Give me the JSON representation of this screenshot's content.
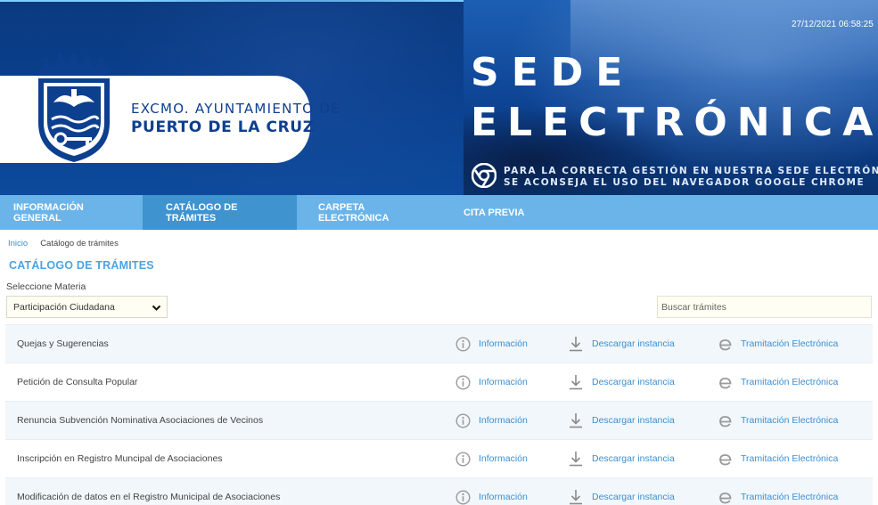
{
  "header": {
    "org_line1": "EXCMO. AYUNTAMIENTO DE",
    "org_line2": "PUERTO DE LA CRUZ",
    "title_line1": "SEDE",
    "title_line2": "ELECTRÓNICA",
    "chrome_note_line1": "PARA LA CORRECTA GESTIÓN EN NUESTRA SEDE ELECTRÓNICA",
    "chrome_note_line2": "SE ACONSEJA EL USO DEL NAVEGADOR GOOGLE CHROME",
    "datetime": "27/12/2021 06:58:25"
  },
  "nav": {
    "items": [
      {
        "label": "INFORMACIÓN GENERAL"
      },
      {
        "label": "CATÁLOGO DE TRÁMITES"
      },
      {
        "label": "CARPETA ELECTRÓNICA"
      },
      {
        "label": "CITA PREVIA"
      }
    ]
  },
  "breadcrumb": {
    "home": "Inicio",
    "current": "Catálogo de trámites"
  },
  "page": {
    "title": "CATÁLOGO DE TRÁMITES",
    "materia_label": "Seleccione Materia",
    "materia_selected": "Participación Ciudadana",
    "search_placeholder": "Buscar trámites"
  },
  "actions": {
    "info": "Información",
    "download": "Descargar instancia",
    "tramitacion": "Tramitación Electrónica"
  },
  "procedures": [
    {
      "name": "Quejas y Sugerencias"
    },
    {
      "name": "Petición de Consulta Popular"
    },
    {
      "name": "Renuncia Subvención Nominativa Asociaciones de Vecinos"
    },
    {
      "name": "Inscripción en Registro Muncipal de Asociaciones"
    },
    {
      "name": "Modificación de datos en el Registro Municipal de Asociaciones"
    }
  ],
  "colors": {
    "nav_bg": "#6ab4ea",
    "nav_active": "#3f93cf",
    "link": "#3b8fd4",
    "brand_blue": "#0d3f8f"
  }
}
